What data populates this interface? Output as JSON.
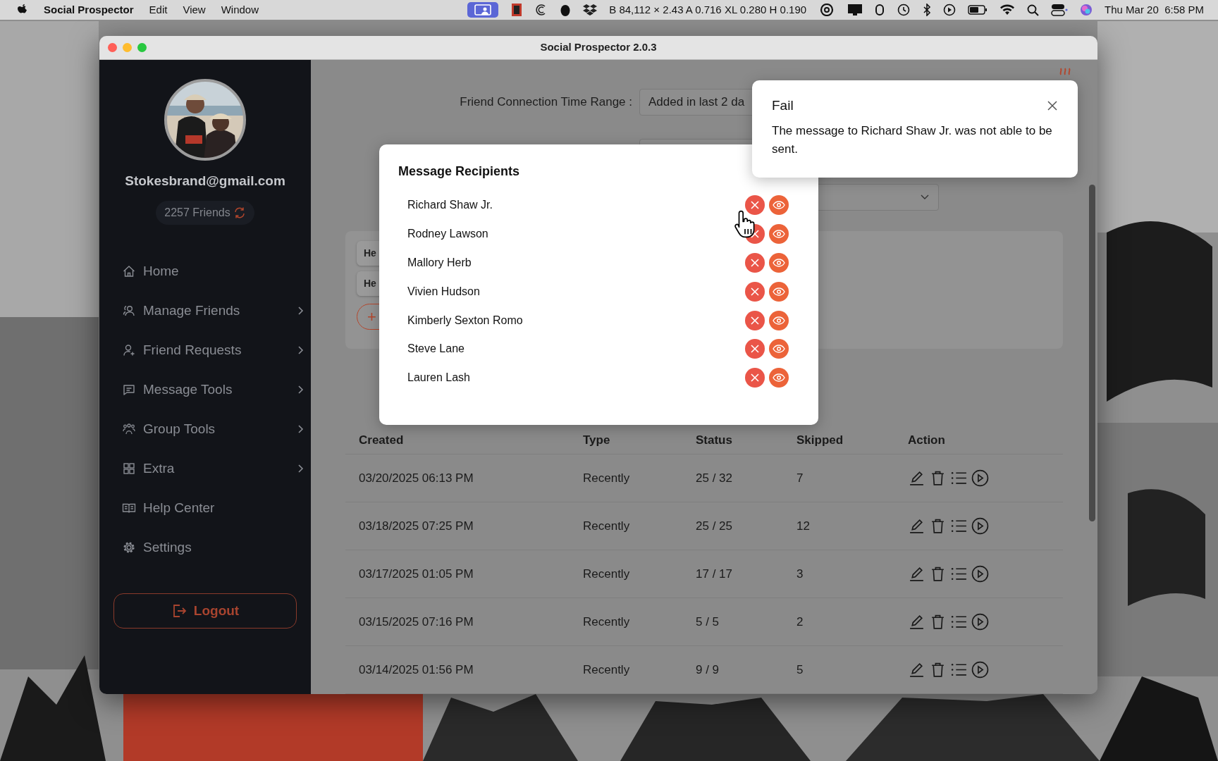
{
  "menu_bar": {
    "app_name": "Social Prospector",
    "menus": [
      "Edit",
      "View",
      "Window"
    ],
    "stats": "B 84,112 × 2.43 A 0.716 XL 0.280 H 0.190",
    "clock": "Thu Mar 20  6:58 PM"
  },
  "window": {
    "title": "Social Prospector 2.0.3"
  },
  "sidebar": {
    "email": "Stokesbrand@gmail.com",
    "friends_count": "2257 Friends",
    "items": [
      {
        "label": "Home",
        "kind": "home",
        "submenu": false
      },
      {
        "label": "Manage Friends",
        "kind": "friends",
        "submenu": true
      },
      {
        "label": "Friend Requests",
        "kind": "requests",
        "submenu": true
      },
      {
        "label": "Message Tools",
        "kind": "messages",
        "submenu": true
      },
      {
        "label": "Group Tools",
        "kind": "groups",
        "submenu": true
      },
      {
        "label": "Extra",
        "kind": "extra",
        "submenu": true
      },
      {
        "label": "Help Center",
        "kind": "help",
        "submenu": false
      },
      {
        "label": "Settings",
        "kind": "settings",
        "submenu": false
      }
    ],
    "logout": "Logout"
  },
  "filters": {
    "time_range_label": "Friend Connection Time Range :",
    "time_range_value": "Added in last 2 da"
  },
  "templates": {
    "chips": [
      "He",
      "He"
    ],
    "add_button": "+"
  },
  "table": {
    "columns": [
      "Created",
      "Type",
      "Status",
      "Skipped",
      "Action"
    ],
    "rows": [
      {
        "created": "03/20/2025 06:13 PM",
        "type": "Recently",
        "status": "25 / 32",
        "skipped": "7"
      },
      {
        "created": "03/18/2025 07:25 PM",
        "type": "Recently",
        "status": "25 / 25",
        "skipped": "12"
      },
      {
        "created": "03/17/2025 01:05 PM",
        "type": "Recently",
        "status": "17 / 17",
        "skipped": "3"
      },
      {
        "created": "03/15/2025 07:16 PM",
        "type": "Recently",
        "status": "5 / 5",
        "skipped": "2"
      },
      {
        "created": "03/14/2025 01:56 PM",
        "type": "Recently",
        "status": "9 / 9",
        "skipped": "5"
      }
    ]
  },
  "modal": {
    "title": "Message Recipients",
    "recipients": [
      {
        "name": "Richard Shaw Jr."
      },
      {
        "name": "Rodney Lawson"
      },
      {
        "name": "Mallory Herb"
      },
      {
        "name": "Vivien Hudson"
      },
      {
        "name": "Kimberly Sexton Romo"
      },
      {
        "name": "Steve Lane"
      },
      {
        "name": "Lauren Lash"
      }
    ]
  },
  "toast": {
    "title": "Fail",
    "message": "The message to Richard Shaw Jr. was not able to be sent."
  }
}
